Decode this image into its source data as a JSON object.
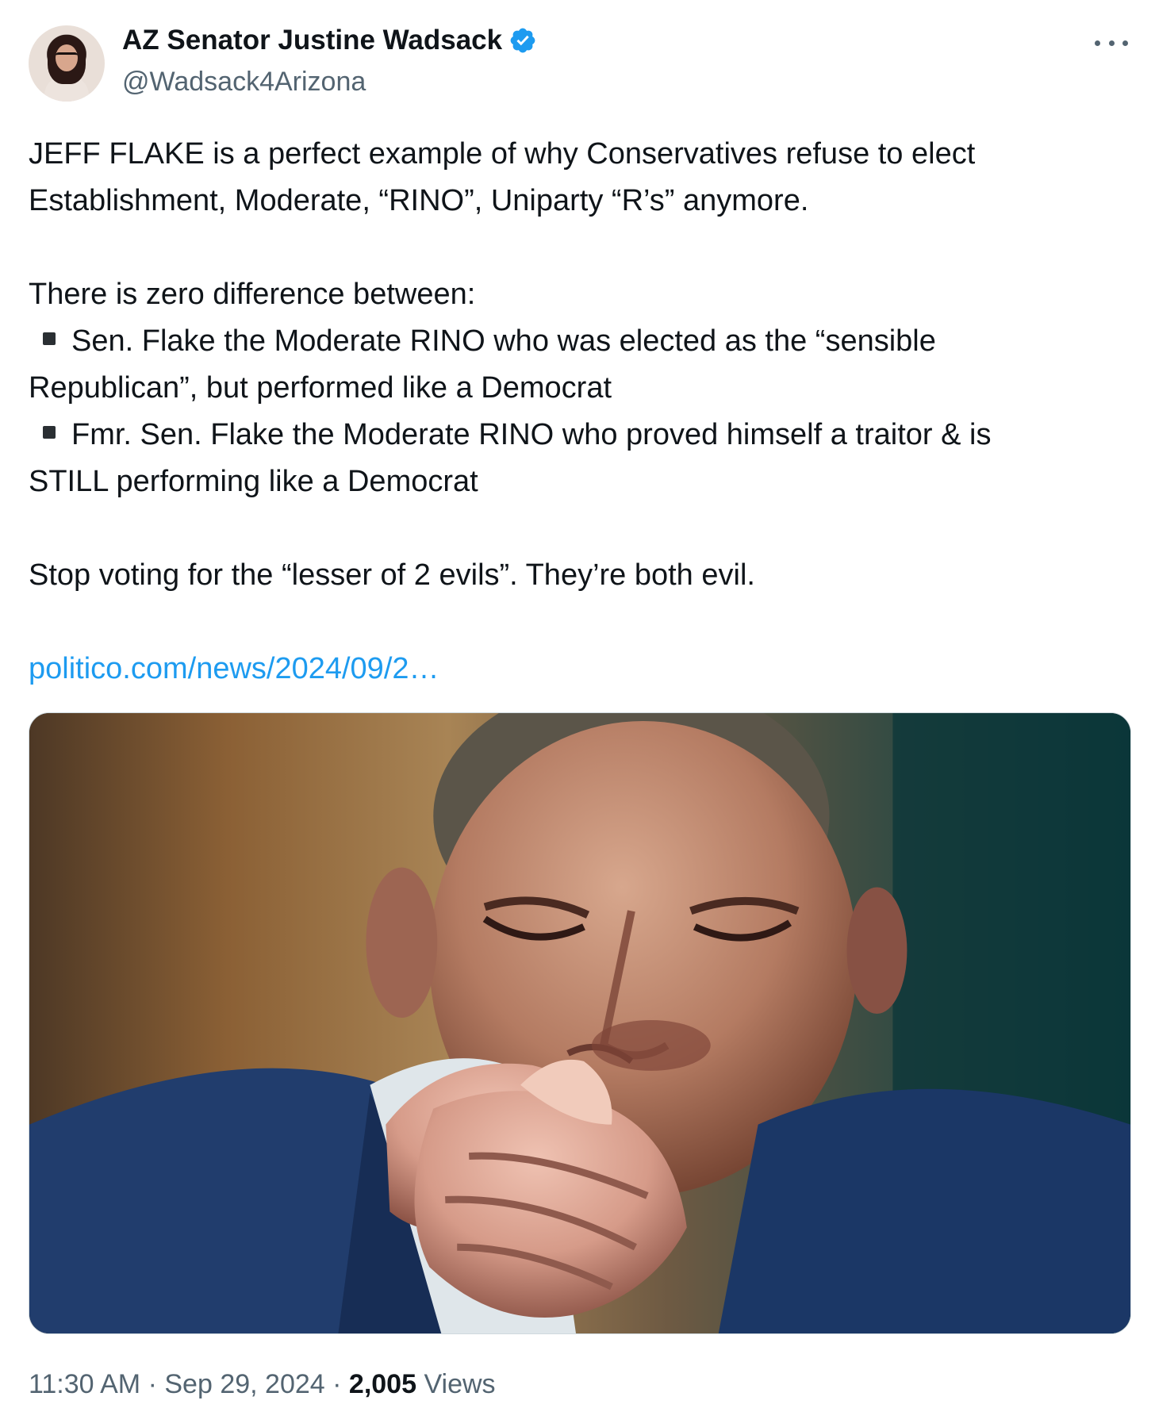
{
  "author": {
    "display_name": "AZ Senator Justine Wadsack",
    "handle": "@Wadsack4Arizona",
    "verified": true,
    "verified_color": "#1d9bf0"
  },
  "tweet": {
    "paragraph1": [
      "JEFF FLAKE is a perfect example of why Conservatives refuse to elect",
      "Establishment, Moderate, “RINO”, Uniparty “R’s” anymore."
    ],
    "intro": "There is zero difference between:",
    "bullets": [
      {
        "first_line": "Sen. Flake the Moderate RINO who was elected as the “sensible",
        "continuation": "Republican”, but performed like a Democrat"
      },
      {
        "first_line": "Fmr. Sen. Flake the Moderate RINO who proved himself a traitor & is",
        "continuation": "STILL performing like a Democrat"
      }
    ],
    "closing": "Stop voting for the “lesser of 2 evils”. They’re both evil.",
    "link_text": "politico.com/news/2024/09/2…",
    "link_color": "#1d9bf0"
  },
  "meta": {
    "time": "11:30 AM",
    "separator": "·",
    "date": "Sep 29, 2024",
    "views_count": "2,005",
    "views_label": "Views"
  },
  "icons": {
    "more": "more-horizontal-icon",
    "verified": "verified-badge-icon"
  }
}
